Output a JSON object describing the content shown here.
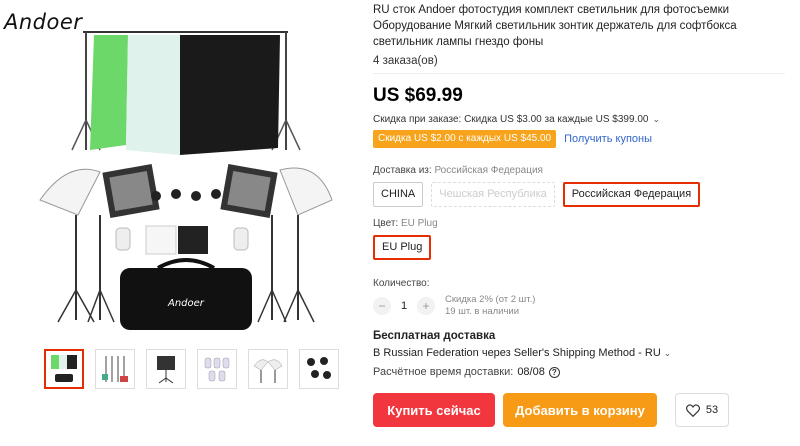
{
  "brand": {
    "logo_text": "Andoer"
  },
  "product": {
    "title": "RU сток Andoer фотостудия комплект светильник для фотосъемки Оборудование Мягкий светильник зонтик держатель для софтбокса светильник лампы гнездо фоны",
    "orders": "4 заказа(ов)",
    "price": "US $69.99",
    "discount_text": "Скидка при заказе: Скидка US $3.00 за каждые US $399.00",
    "discount_chevron": "⌄",
    "coupon_badge": "Скидка US $2.00 с каждых US $45.00",
    "coupon_link": "Получить купоны"
  },
  "shipping_from": {
    "label": "Доставка из:",
    "selected_value": "Российская Федерация",
    "options": [
      {
        "label": "CHINA",
        "state": "normal"
      },
      {
        "label": "Чешская Республика",
        "state": "disabled"
      },
      {
        "label": "Российская Федерация",
        "state": "selected"
      }
    ]
  },
  "color": {
    "label": "Цвет:",
    "selected_value": "EU Plug",
    "options": [
      {
        "label": "EU Plug",
        "state": "selected"
      }
    ]
  },
  "quantity": {
    "label": "Количество:",
    "minus": "−",
    "value": "1",
    "plus": "+",
    "discount_note": "Скидка 2% (от 2 шт.)",
    "stock_note": "19 шт. в наличии"
  },
  "delivery": {
    "free_shipping": "Бесплатная доставка",
    "method": "В Russian Federation через Seller's Shipping Method - RU",
    "method_chevron": "⌄",
    "estimate_label": "Расчётное время доставки:",
    "estimate_value": "08/08",
    "help_glyph": "?"
  },
  "actions": {
    "buy_now": "Купить сейчас",
    "add_to_cart": "Добавить в корзину",
    "wishlist_count": "53"
  },
  "colors": {
    "price_red": "#e62e04",
    "buy_button": "#f1363d",
    "cart_button": "#f79a15",
    "coupon_badge": "#f7a31b",
    "link_blue": "#3366cc"
  },
  "thumbnails": [
    {
      "icon": "studio-kit-thumb"
    },
    {
      "icon": "light-stands-thumb"
    },
    {
      "icon": "softbox-thumb"
    },
    {
      "icon": "bulbs-thumb"
    },
    {
      "icon": "umbrellas-thumb"
    },
    {
      "icon": "socket-holders-thumb"
    }
  ]
}
